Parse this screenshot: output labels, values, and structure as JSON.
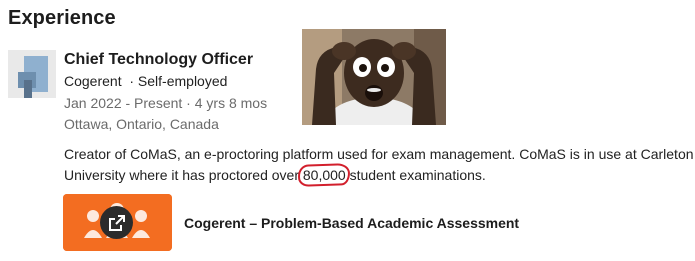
{
  "section": {
    "title": "Experience"
  },
  "experience": {
    "title": "Chief Technology Officer",
    "company_line": "Cogerent  · Self-employed",
    "dates": "Jan 2022 - Present · 4 yrs 8 mos",
    "location": "Ottawa, Ontario, Canada",
    "description": {
      "line1": "Creator of CoMaS, an e-proctoring platform used for exam management. CoMaS is in use at Carleton",
      "line2_before": "University where it has proctored over ",
      "line2_highlight": "80,000",
      "line2_after": " student examinations."
    },
    "media": {
      "title": "Cogerent – Problem-Based Academic Assessment"
    }
  },
  "colors": {
    "accent_orange": "#f36d21",
    "annotation_red": "#d21f2c"
  },
  "icons": {
    "logo": "company-logo",
    "external_link": "external-link-icon"
  }
}
